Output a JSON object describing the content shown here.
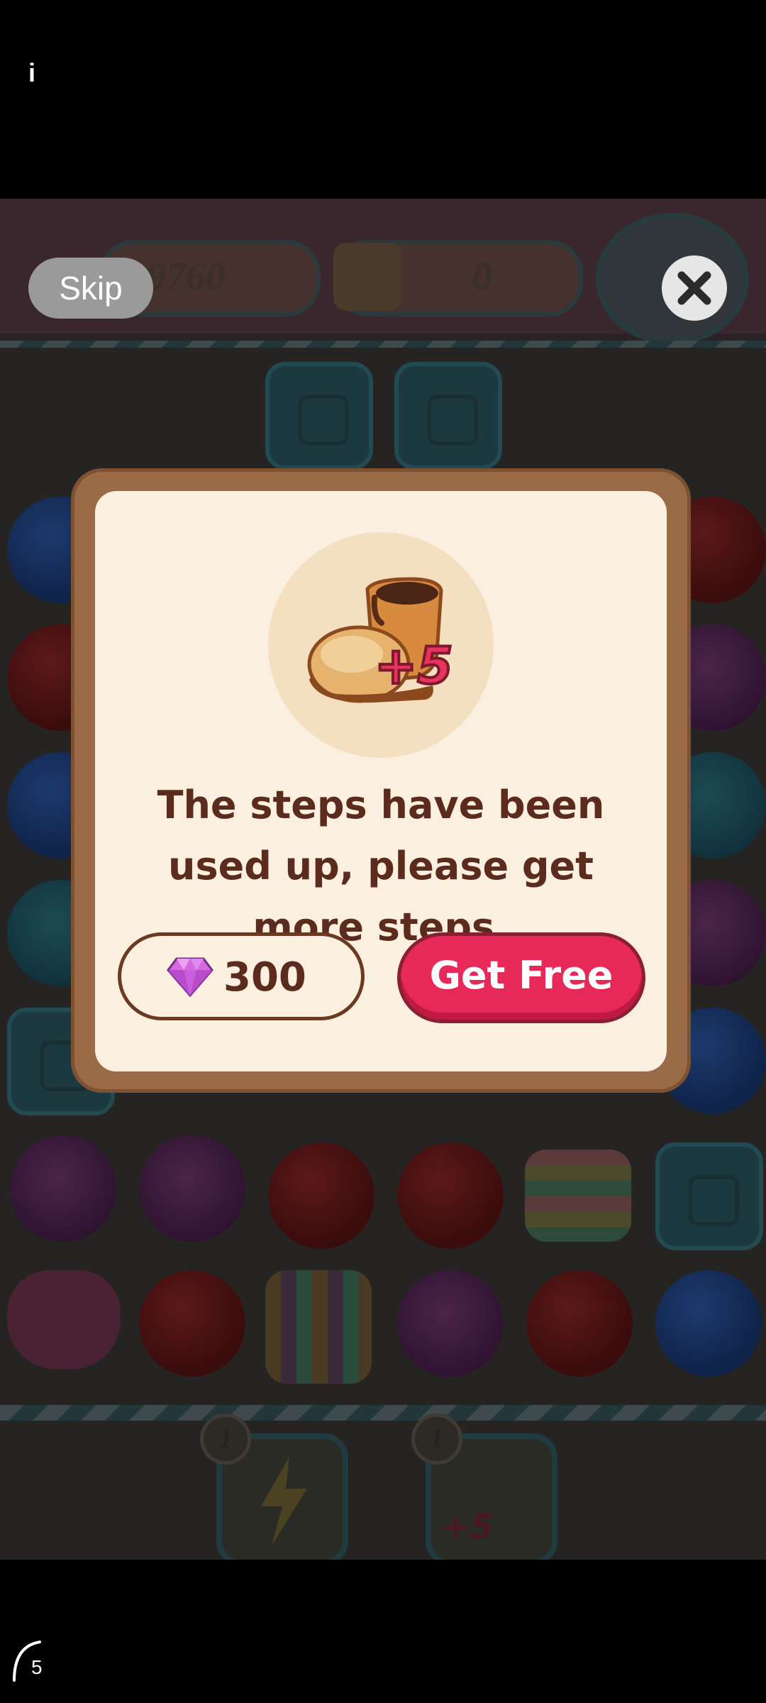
{
  "status": {
    "info_label": "i"
  },
  "game": {
    "score": "9760",
    "moves_counter": "0",
    "booster_1_count": "1",
    "booster_2_count": "1",
    "booster_2_bonus": "+5"
  },
  "overlay": {
    "skip_label": "Skip",
    "close_icon": "close-icon"
  },
  "dialog": {
    "reward_icon": "boot-icon",
    "reward_bonus": "+5",
    "message": "The steps have been used up, please get more steps.",
    "gem_price": "300",
    "gem_icon": "gem-icon",
    "free_label": "Get Free"
  },
  "footer": {
    "timer_count": "5"
  },
  "colors": {
    "frame": "#9a6b46",
    "panel": "#fbf0e0",
    "text": "#5b2b1e",
    "accent": "#e62958"
  }
}
